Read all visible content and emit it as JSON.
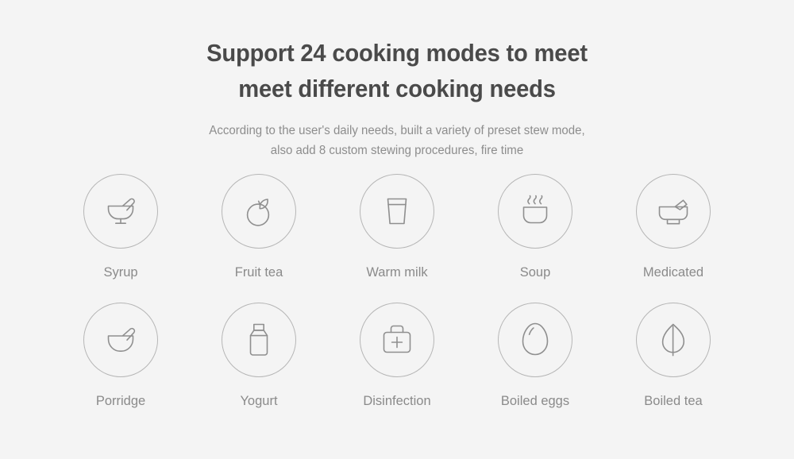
{
  "page": {
    "background_color": "#f4f4f4",
    "title_color": "#4a4a4a",
    "text_color": "#8a8a8a",
    "icon_stroke_color": "#8f8f8f",
    "circle_stroke_color": "#b6b6b6"
  },
  "header": {
    "title_line_1": "Support 24 cooking modes to meet",
    "title_line_2": "meet different cooking needs",
    "subtitle_line_1": "According to the user's daily needs, built a variety of preset stew mode,",
    "subtitle_line_2": "also add 8 custom stewing procedures, fire time"
  },
  "modes": {
    "row1": [
      {
        "label": "Syrup",
        "icon": "mortar-pestle-stem-icon"
      },
      {
        "label": "Fruit tea",
        "icon": "fruit-leaf-icon"
      },
      {
        "label": "Warm milk",
        "icon": "milk-glass-icon"
      },
      {
        "label": "Soup",
        "icon": "steaming-bowl-icon"
      },
      {
        "label": "Medicated",
        "icon": "mortar-pestle-flat-icon"
      }
    ],
    "row2": [
      {
        "label": "Porridge",
        "icon": "bowl-spoon-icon"
      },
      {
        "label": "Yogurt",
        "icon": "yogurt-bottle-icon"
      },
      {
        "label": "Disinfection",
        "icon": "medical-kit-icon"
      },
      {
        "label": "Boiled eggs",
        "icon": "egg-icon"
      },
      {
        "label": "Boiled tea",
        "icon": "tea-leaf-icon"
      }
    ]
  }
}
